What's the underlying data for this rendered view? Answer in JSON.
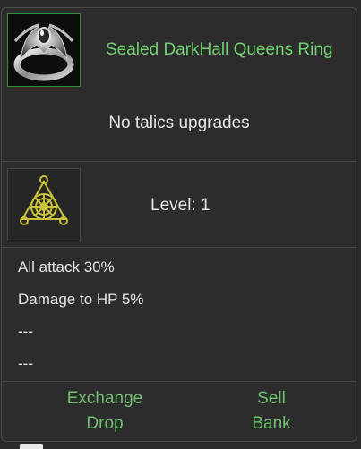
{
  "item": {
    "name": "Sealed DarkHall Queens Ring",
    "icon": "ring-icon",
    "name_color": "#6fd16f"
  },
  "talics": {
    "text": "No talics upgrades"
  },
  "level": {
    "icon": "talic-emblem-icon",
    "text": "Level: 1"
  },
  "stats": [
    "All attack 30%",
    "Damage to HP 5%",
    "---",
    "---"
  ],
  "actions": {
    "exchange": "Exchange",
    "sell": "Sell",
    "drop": "Drop",
    "bank": "Bank",
    "color": "#6fbf6f"
  }
}
